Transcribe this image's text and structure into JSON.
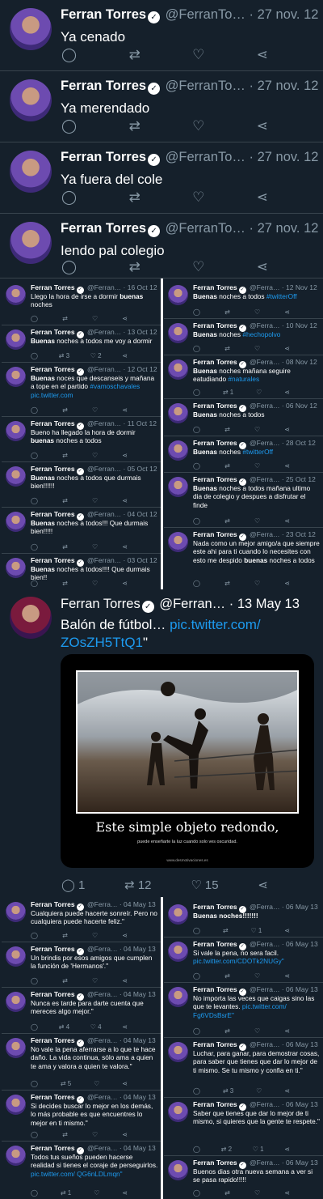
{
  "author": {
    "name": "Ferran Torres",
    "verified_symbol": "✓"
  },
  "icons": {
    "reply": "reply-icon",
    "retweet": "retweet-icon",
    "like": "like-icon",
    "share": "share-icon"
  },
  "glyphs": {
    "reply": "◯",
    "retweet": "⇄",
    "like": "♡",
    "share": "⋖"
  },
  "big_tweets": [
    {
      "handle": "@FerranTo…",
      "date": "· 27 nov. 12",
      "text": "Ya cenado"
    },
    {
      "handle": "@FerranTo…",
      "date": "· 27 nov. 12",
      "text": "Ya merendado"
    },
    {
      "handle": "@FerranTo…",
      "date": "· 27 nov. 12",
      "text": "Ya fuera del cole"
    },
    {
      "handle": "@FerranTo…",
      "date": "· 27 nov. 12",
      "text": "Iendo pal colegio"
    }
  ],
  "grid1_left": [
    {
      "handle": "@Ferran…",
      "date": "· 16 Oct 12",
      "pre": "Llego la hora de irse a dormir ",
      "hl": "buenas",
      "post": " noches",
      "link": "",
      "rt": "",
      "lk": ""
    },
    {
      "handle": "@Ferran…",
      "date": "· 13 Oct 12",
      "pre": "",
      "hl": "Buenas",
      "post": " noches a todos me voy a dormir",
      "link": "",
      "rt": "3",
      "lk": "2"
    },
    {
      "handle": "@Ferran…",
      "date": "· 12 Oct 12",
      "pre": "",
      "hl": "Buenas",
      "post": " noces que descanseis y mañana a tope en el partido ",
      "link": "#vamoschavales pic.twitter.com",
      "rt": "",
      "lk": ""
    },
    {
      "handle": "@Ferran…",
      "date": "· 11 Oct 12",
      "pre": "Bueno ha llegado la hora de dormir ",
      "hl": "buenas",
      "post": " noches a todos",
      "link": "",
      "rt": "",
      "lk": ""
    },
    {
      "handle": "@Ferran…",
      "date": "· 05 Oct 12",
      "pre": "",
      "hl": "Buenas",
      "post": " noches a todos que durmais bien!!!!!!",
      "link": "",
      "rt": "",
      "lk": ""
    },
    {
      "handle": "@Ferran…",
      "date": "· 04 Oct 12",
      "pre": "",
      "hl": "Buenas",
      "post": " noches a todos!!! Que durmais bien!!!!!",
      "link": "",
      "rt": "",
      "lk": ""
    },
    {
      "handle": "@Ferran…",
      "date": "· 03 Oct 12",
      "pre": "",
      "hl": "Buenas",
      "post": " noches a todos!!!! Que durmais bien!!",
      "link": "",
      "rt": "",
      "lk": ""
    }
  ],
  "grid1_right": [
    {
      "handle": "@Ferra…",
      "date": "· 12 Nov 12",
      "pre": "",
      "hl": "Buenas",
      "post": " noches a todos ",
      "link": "#twitterOff",
      "rt": "",
      "lk": ""
    },
    {
      "handle": "@Ferra…",
      "date": "· 10 Nov 12",
      "pre": "",
      "hl": "Buenas",
      "post": " noches ",
      "link": "#hechopolvo",
      "rt": "",
      "lk": ""
    },
    {
      "handle": "@Ferra…",
      "date": "· 08 Nov 12",
      "pre": "",
      "hl": "Buenas",
      "post": " noches mañana seguire eatudiando ",
      "link": "#naturales",
      "rt": "1",
      "lk": ""
    },
    {
      "handle": "@Ferra…",
      "date": "· 06 Nov 12",
      "pre": "",
      "hl": "Buenas",
      "post": " noches a todos",
      "link": "",
      "rt": "",
      "lk": ""
    },
    {
      "handle": "@Ferra…",
      "date": "· 28 Oct 12",
      "pre": "",
      "hl": "Buenas",
      "post": " noches ",
      "link": "#twitterOff",
      "rt": "",
      "lk": ""
    },
    {
      "handle": "@Ferra…",
      "date": "· 25 Oct 12",
      "pre": "",
      "hl": "Buenas",
      "post": " noches a todos mañana ultimo dia de colegio y despues a disfrutar el finde",
      "link": "",
      "rt": "",
      "lk": ""
    },
    {
      "handle": "@Ferra…",
      "date": "· 23 Oct 12",
      "pre": "Nada como un mejor amigo/a que siempre este ahi para ti cuando lo necesites con esto me despido ",
      "hl": "buenas",
      "post": " noches a todos",
      "link": "",
      "rt": "",
      "lk": ""
    }
  ],
  "feature": {
    "handle": "@Ferran…",
    "date": "· 13 May 13",
    "text": "Balón de fútbol… ",
    "link": "pic.twitter.com/ ZOsZH5TtQ1",
    "text_end": "\"",
    "replies": "1",
    "retweets": "12",
    "likes": "15",
    "media_title": "Este simple objeto redondo,",
    "media_sub": "puede enseñarte la luz cuando solo ves oscuridad.",
    "media_url": "www.desmotivaciones.es"
  },
  "grid2_left": [
    {
      "handle": "@Ferra…",
      "date": "· 04 May 13",
      "pre": "Cualquiera puede hacerte sonreír. Pero no cualquiera puede hacerte feliz.\"",
      "hl": "",
      "post": "",
      "link": "",
      "rt": "",
      "lk": ""
    },
    {
      "handle": "@Ferra…",
      "date": "· 04 May 13",
      "pre": "Un brindis por esos amigos que cumplen la función de 'Hermanos'.\"",
      "hl": "",
      "post": "",
      "link": "",
      "rt": "",
      "lk": ""
    },
    {
      "handle": "@Ferra…",
      "date": "· 04 May 13",
      "pre": "Nunca es tarde para darte cuenta que mereces algo mejor.\"",
      "hl": "",
      "post": "",
      "link": "",
      "rt": "4",
      "lk": "4"
    },
    {
      "handle": "@Ferra…",
      "date": "· 04 May 13",
      "pre": "No vale la pena aferrarse a lo que te hace daño. La vida continua, sólo ama a quien te ama y valora a quien te valora.\"",
      "hl": "",
      "post": "",
      "link": "",
      "rt": "5",
      "lk": ""
    },
    {
      "handle": "@Ferra…",
      "date": "· 04 May 13",
      "pre": "Si decides buscar lo mejor en los demás, lo más probable es que encuentres lo mejor en ti mismo.\"",
      "hl": "",
      "post": "",
      "link": "",
      "rt": "",
      "lk": ""
    },
    {
      "handle": "@Ferra…",
      "date": "· 04 May 13",
      "pre": "Todos tus sueños pueden hacerse realidad si tienes el coraje de perseguirlos. ",
      "hl": "",
      "post": "",
      "link": "pic.twitter.com/ QG6nLDLmqn\"",
      "rt": "1",
      "lk": ""
    }
  ],
  "grid2_right": [
    {
      "handle": "@Ferra…",
      "date": "· 06 May 13",
      "pre": "",
      "hl": "Buenas noches!!!!!!!",
      "post": "",
      "link": "",
      "rt": "",
      "lk": "1"
    },
    {
      "handle": "@Ferra…",
      "date": "· 06 May 13",
      "pre": "Si vale la pena, no sera facil. ",
      "hl": "",
      "post": "",
      "link": "pic.twitter.com/CDOTk2NUGy\"",
      "rt": "",
      "lk": ""
    },
    {
      "handle": "@Ferra…",
      "date": "· 06 May 13",
      "pre": "No importa las veces que caigas sino las que te levantes. ",
      "hl": "",
      "post": "",
      "link": "pic.twitter.com/ Fg6VDsBsrE\"",
      "rt": "",
      "lk": ""
    },
    {
      "handle": "@Ferra…",
      "date": "· 06 May 13",
      "pre": "Luchar, para ganar, para demostrar cosas, para saber que tienes que dar lo mejor de ti mismo. Se tu mismo y confia en ti.\"",
      "hl": "",
      "post": "",
      "link": "",
      "rt": "3",
      "lk": ""
    },
    {
      "handle": "@Ferra…",
      "date": "· 06 May 13",
      "pre": "Saber que tienes que dar lo mejor de ti mismo, si quieres que la gente te respete.\"",
      "hl": "",
      "post": "",
      "link": "",
      "rt": "2",
      "lk": "1"
    },
    {
      "handle": "@Ferra…",
      "date": "· 06 May 13",
      "pre": "Buenos dias otra nueva semana a ver si se pasa rapido!!!!!",
      "hl": "",
      "post": "",
      "link": "",
      "rt": "",
      "lk": ""
    }
  ]
}
